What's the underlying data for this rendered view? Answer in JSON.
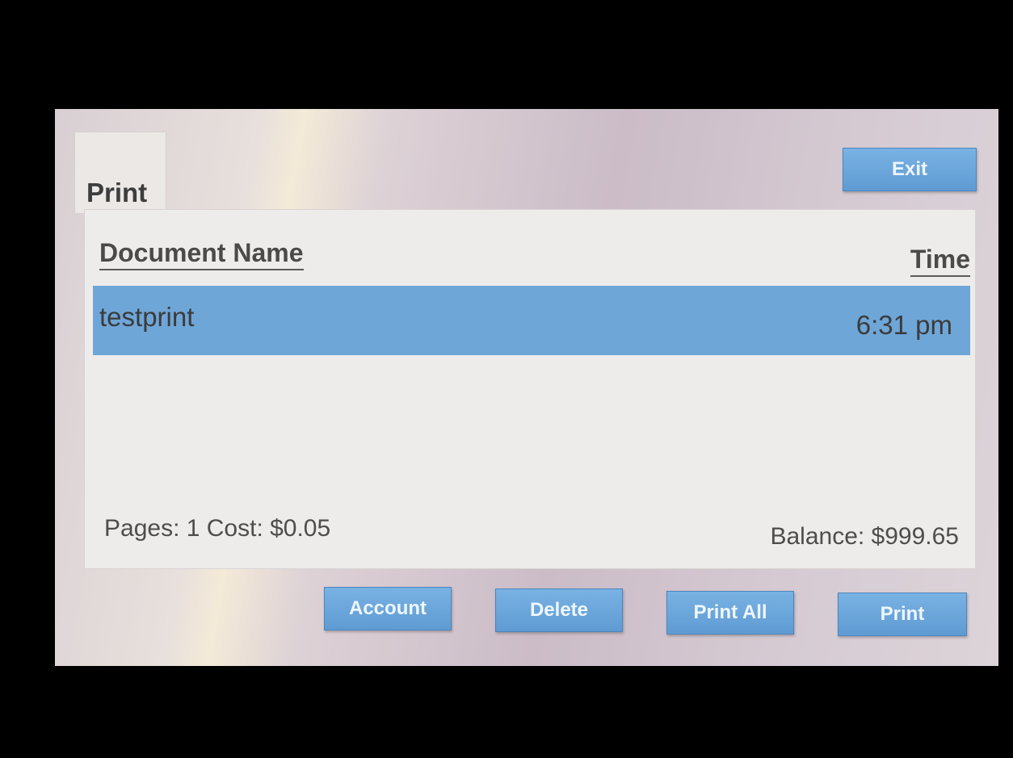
{
  "tab": {
    "label": "Print"
  },
  "toolbar": {
    "exit_label": "Exit"
  },
  "table": {
    "headers": {
      "document_name": "Document Name",
      "time": "Time"
    },
    "rows": [
      {
        "name": "testprint",
        "time": "6:31 pm",
        "selected": true
      }
    ]
  },
  "summary": {
    "pages_cost": "Pages: 1 Cost: $0.05",
    "balance": "Balance:  $999.65"
  },
  "actions": {
    "account": "Account",
    "delete": "Delete",
    "print_all": "Print All",
    "print": "Print"
  },
  "colors": {
    "selected_row": "#6ea6d8",
    "button": "#6aa6dc",
    "panel": "#eeecea"
  }
}
